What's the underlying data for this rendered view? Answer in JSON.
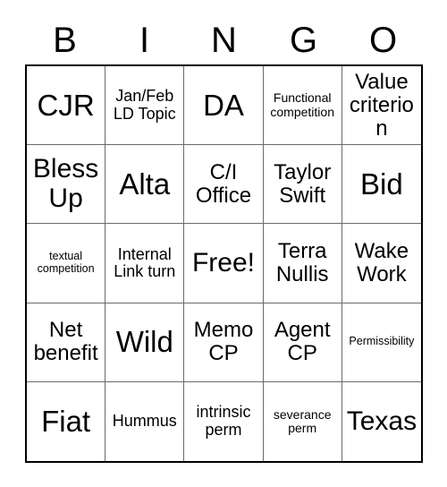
{
  "card": {
    "title_letters": [
      "B",
      "I",
      "N",
      "G",
      "O"
    ],
    "free_space_label": "Free!",
    "colors": {
      "text": "#000000",
      "background": "#ffffff",
      "grid_line": "#6b6b6b",
      "outer_border": "#000000"
    },
    "grid_size": "5x5",
    "cells": [
      {
        "text": "CJR",
        "size": "xl"
      },
      {
        "text": "Jan/Feb LD Topic",
        "size": "sm"
      },
      {
        "text": "DA",
        "size": "xl"
      },
      {
        "text": "Functional competition",
        "size": "xs"
      },
      {
        "text": "Value criterion",
        "size": "md"
      },
      {
        "text": "Bless Up",
        "size": "lg"
      },
      {
        "text": "Alta",
        "size": "xl"
      },
      {
        "text": "C/I Office",
        "size": "md"
      },
      {
        "text": "Taylor Swift",
        "size": "md"
      },
      {
        "text": "Bid",
        "size": "xl"
      },
      {
        "text": "textual competition",
        "size": "xxs"
      },
      {
        "text": "Internal Link turn",
        "size": "sm"
      },
      {
        "text": "Free!",
        "size": "lg"
      },
      {
        "text": "Terra Nullis",
        "size": "md"
      },
      {
        "text": "Wake Work",
        "size": "md"
      },
      {
        "text": "Net benefit",
        "size": "md"
      },
      {
        "text": "Wild",
        "size": "xl"
      },
      {
        "text": "Memo CP",
        "size": "md"
      },
      {
        "text": "Agent CP",
        "size": "md"
      },
      {
        "text": "Permissibility",
        "size": "xxs"
      },
      {
        "text": "Fiat",
        "size": "xl"
      },
      {
        "text": "Hummus",
        "size": "sm"
      },
      {
        "text": "intrinsic perm",
        "size": "sm"
      },
      {
        "text": "severance perm",
        "size": "xs"
      },
      {
        "text": "Texas",
        "size": "lg"
      }
    ]
  }
}
